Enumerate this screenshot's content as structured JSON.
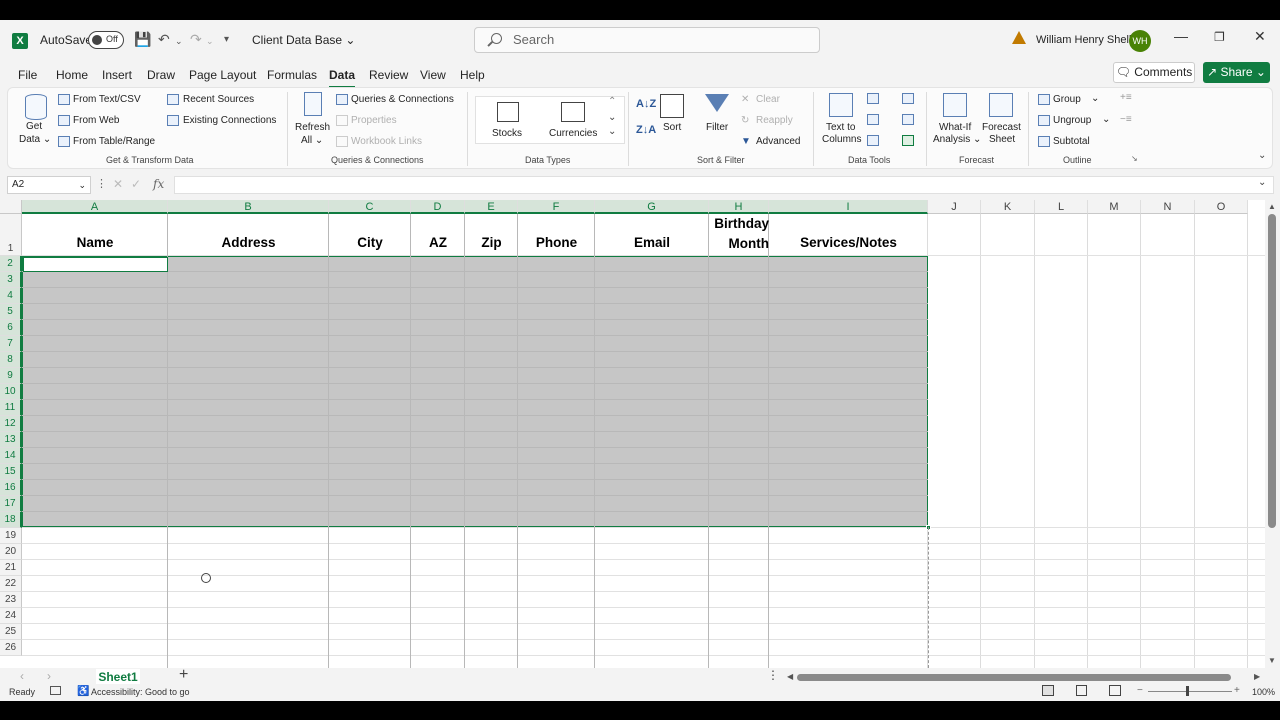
{
  "titlebar": {
    "autosave_label": "AutoSave",
    "autosave_state": "Off",
    "doc_name": "Client Data Base ⌄",
    "search_placeholder": "Search",
    "user_name": "William Henry Shell",
    "user_initials": "WH"
  },
  "menu": {
    "items": [
      "File",
      "Home",
      "Insert",
      "Draw",
      "Page Layout",
      "Formulas",
      "Data",
      "Review",
      "View",
      "Help"
    ],
    "active": "Data",
    "comments_label": "Comments",
    "share_label": "Share"
  },
  "ribbon": {
    "get_data": {
      "line1": "Get",
      "line2": "Data ⌄"
    },
    "from_text_csv": "From Text/CSV",
    "from_web": "From Web",
    "from_table_range": "From Table/Range",
    "recent_sources": "Recent Sources",
    "existing_connections": "Existing Connections",
    "group_get_transform": "Get & Transform Data",
    "refresh": {
      "line1": "Refresh",
      "line2": "All ⌄"
    },
    "queries_connections": "Queries & Connections",
    "properties": "Properties",
    "workbook_links": "Workbook Links",
    "group_queries": "Queries & Connections",
    "stocks": "Stocks",
    "currencies": "Currencies",
    "group_data_types": "Data Types",
    "sort": "Sort",
    "filter": "Filter",
    "clear": "Clear",
    "reapply": "Reapply",
    "advanced": "Advanced",
    "group_sort_filter": "Sort & Filter",
    "text_to_columns": {
      "line1": "Text to",
      "line2": "Columns"
    },
    "group_data_tools": "Data Tools",
    "what_if": {
      "line1": "What-If",
      "line2": "Analysis ⌄"
    },
    "forecast_sheet": {
      "line1": "Forecast",
      "line2": "Sheet"
    },
    "group_forecast": "Forecast",
    "group": "Group",
    "ungroup": "Ungroup",
    "subtotal": "Subtotal",
    "group_outline": "Outline"
  },
  "formula_bar": {
    "name_box": "A2",
    "fx": "fx",
    "content": ""
  },
  "sheet": {
    "columns": [
      "A",
      "B",
      "C",
      "D",
      "E",
      "F",
      "G",
      "H",
      "I",
      "J",
      "K",
      "L",
      "M",
      "N",
      "O"
    ],
    "rows": [
      "1",
      "2",
      "3",
      "4",
      "5",
      "6",
      "7",
      "8",
      "9",
      "10",
      "11",
      "12",
      "13",
      "14",
      "15",
      "16",
      "17",
      "18",
      "19",
      "20",
      "21",
      "22",
      "23",
      "24",
      "25",
      "26"
    ],
    "headers": {
      "name": "Name",
      "address": "Address",
      "city": "City",
      "az": "AZ",
      "zip": "Zip",
      "phone": "Phone",
      "email": "Email",
      "birthday_line1": "Birthday",
      "birthday_line2": "Month",
      "services": "Services/Notes"
    },
    "selection": "A2:I18",
    "tab_name": "Sheet1"
  },
  "status": {
    "ready": "Ready",
    "accessibility": "Accessibility: Good to go",
    "zoom": "100%"
  }
}
